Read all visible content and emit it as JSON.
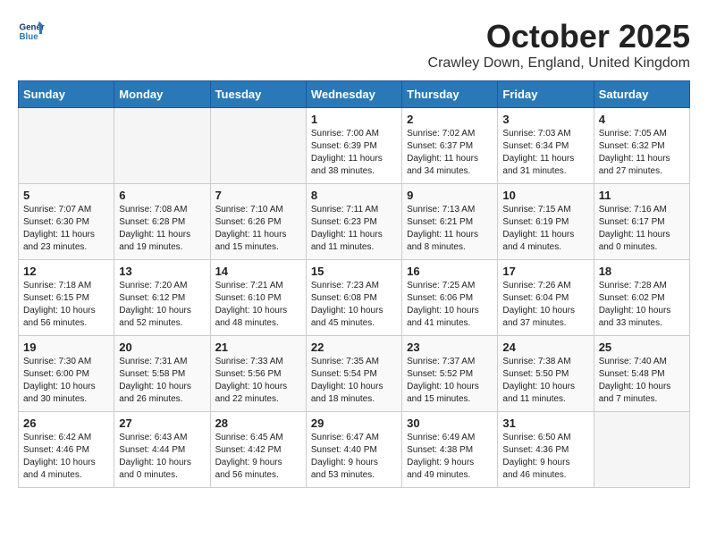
{
  "header": {
    "logo_general": "General",
    "logo_blue": "Blue",
    "month": "October 2025",
    "location": "Crawley Down, England, United Kingdom"
  },
  "days_of_week": [
    "Sunday",
    "Monday",
    "Tuesday",
    "Wednesday",
    "Thursday",
    "Friday",
    "Saturday"
  ],
  "weeks": [
    [
      {
        "day": "",
        "info": ""
      },
      {
        "day": "",
        "info": ""
      },
      {
        "day": "",
        "info": ""
      },
      {
        "day": "1",
        "info": "Sunrise: 7:00 AM\nSunset: 6:39 PM\nDaylight: 11 hours\nand 38 minutes."
      },
      {
        "day": "2",
        "info": "Sunrise: 7:02 AM\nSunset: 6:37 PM\nDaylight: 11 hours\nand 34 minutes."
      },
      {
        "day": "3",
        "info": "Sunrise: 7:03 AM\nSunset: 6:34 PM\nDaylight: 11 hours\nand 31 minutes."
      },
      {
        "day": "4",
        "info": "Sunrise: 7:05 AM\nSunset: 6:32 PM\nDaylight: 11 hours\nand 27 minutes."
      }
    ],
    [
      {
        "day": "5",
        "info": "Sunrise: 7:07 AM\nSunset: 6:30 PM\nDaylight: 11 hours\nand 23 minutes."
      },
      {
        "day": "6",
        "info": "Sunrise: 7:08 AM\nSunset: 6:28 PM\nDaylight: 11 hours\nand 19 minutes."
      },
      {
        "day": "7",
        "info": "Sunrise: 7:10 AM\nSunset: 6:26 PM\nDaylight: 11 hours\nand 15 minutes."
      },
      {
        "day": "8",
        "info": "Sunrise: 7:11 AM\nSunset: 6:23 PM\nDaylight: 11 hours\nand 11 minutes."
      },
      {
        "day": "9",
        "info": "Sunrise: 7:13 AM\nSunset: 6:21 PM\nDaylight: 11 hours\nand 8 minutes."
      },
      {
        "day": "10",
        "info": "Sunrise: 7:15 AM\nSunset: 6:19 PM\nDaylight: 11 hours\nand 4 minutes."
      },
      {
        "day": "11",
        "info": "Sunrise: 7:16 AM\nSunset: 6:17 PM\nDaylight: 11 hours\nand 0 minutes."
      }
    ],
    [
      {
        "day": "12",
        "info": "Sunrise: 7:18 AM\nSunset: 6:15 PM\nDaylight: 10 hours\nand 56 minutes."
      },
      {
        "day": "13",
        "info": "Sunrise: 7:20 AM\nSunset: 6:12 PM\nDaylight: 10 hours\nand 52 minutes."
      },
      {
        "day": "14",
        "info": "Sunrise: 7:21 AM\nSunset: 6:10 PM\nDaylight: 10 hours\nand 48 minutes."
      },
      {
        "day": "15",
        "info": "Sunrise: 7:23 AM\nSunset: 6:08 PM\nDaylight: 10 hours\nand 45 minutes."
      },
      {
        "day": "16",
        "info": "Sunrise: 7:25 AM\nSunset: 6:06 PM\nDaylight: 10 hours\nand 41 minutes."
      },
      {
        "day": "17",
        "info": "Sunrise: 7:26 AM\nSunset: 6:04 PM\nDaylight: 10 hours\nand 37 minutes."
      },
      {
        "day": "18",
        "info": "Sunrise: 7:28 AM\nSunset: 6:02 PM\nDaylight: 10 hours\nand 33 minutes."
      }
    ],
    [
      {
        "day": "19",
        "info": "Sunrise: 7:30 AM\nSunset: 6:00 PM\nDaylight: 10 hours\nand 30 minutes."
      },
      {
        "day": "20",
        "info": "Sunrise: 7:31 AM\nSunset: 5:58 PM\nDaylight: 10 hours\nand 26 minutes."
      },
      {
        "day": "21",
        "info": "Sunrise: 7:33 AM\nSunset: 5:56 PM\nDaylight: 10 hours\nand 22 minutes."
      },
      {
        "day": "22",
        "info": "Sunrise: 7:35 AM\nSunset: 5:54 PM\nDaylight: 10 hours\nand 18 minutes."
      },
      {
        "day": "23",
        "info": "Sunrise: 7:37 AM\nSunset: 5:52 PM\nDaylight: 10 hours\nand 15 minutes."
      },
      {
        "day": "24",
        "info": "Sunrise: 7:38 AM\nSunset: 5:50 PM\nDaylight: 10 hours\nand 11 minutes."
      },
      {
        "day": "25",
        "info": "Sunrise: 7:40 AM\nSunset: 5:48 PM\nDaylight: 10 hours\nand 7 minutes."
      }
    ],
    [
      {
        "day": "26",
        "info": "Sunrise: 6:42 AM\nSunset: 4:46 PM\nDaylight: 10 hours\nand 4 minutes."
      },
      {
        "day": "27",
        "info": "Sunrise: 6:43 AM\nSunset: 4:44 PM\nDaylight: 10 hours\nand 0 minutes."
      },
      {
        "day": "28",
        "info": "Sunrise: 6:45 AM\nSunset: 4:42 PM\nDaylight: 9 hours\nand 56 minutes."
      },
      {
        "day": "29",
        "info": "Sunrise: 6:47 AM\nSunset: 4:40 PM\nDaylight: 9 hours\nand 53 minutes."
      },
      {
        "day": "30",
        "info": "Sunrise: 6:49 AM\nSunset: 4:38 PM\nDaylight: 9 hours\nand 49 minutes."
      },
      {
        "day": "31",
        "info": "Sunrise: 6:50 AM\nSunset: 4:36 PM\nDaylight: 9 hours\nand 46 minutes."
      },
      {
        "day": "",
        "info": ""
      }
    ]
  ]
}
